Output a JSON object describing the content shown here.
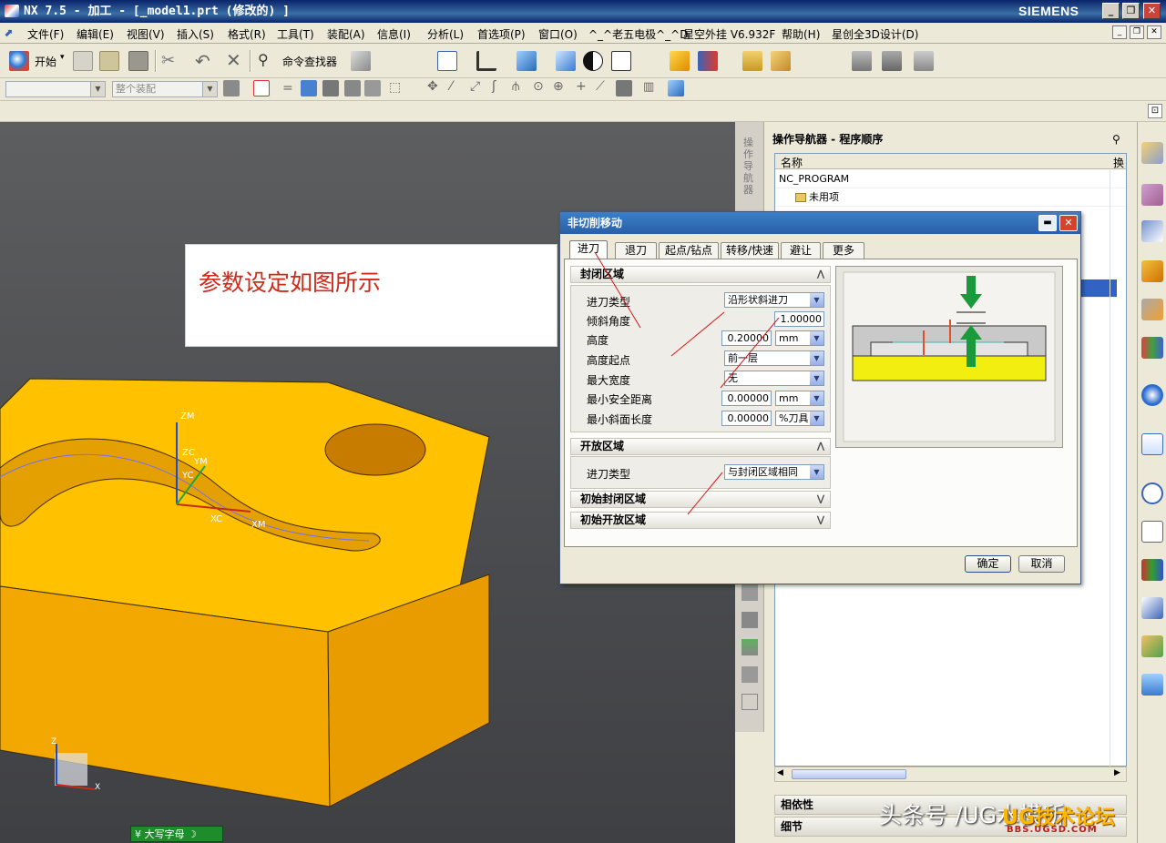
{
  "window": {
    "title": "NX 7.5 - 加工 - [_model1.prt  (修改的) ]",
    "brand": "SIEMENS",
    "minimize": "_",
    "restore": "❐",
    "close": "✕"
  },
  "menubar": {
    "items": [
      "文件(F)",
      "编辑(E)",
      "视图(V)",
      "插入(S)",
      "格式(R)",
      "工具(T)",
      "装配(A)",
      "信息(I)",
      "分析(L)",
      "首选项(P)",
      "窗口(O)",
      "^_^老五电极^_^D",
      "星空外挂 V6.932F",
      "帮助(H)",
      "星创全3D设计(D)"
    ]
  },
  "toolbar": {
    "start_label": "开始",
    "command_finder_label": "命令查找器",
    "filter_placeholder": "",
    "assembly_combo": "整个装配"
  },
  "viewport": {
    "note": "参数设定如图所示",
    "axis_labels": [
      "ZM",
      "ZC",
      "YM",
      "YC",
      "XC",
      "XM"
    ],
    "triad_labels": [
      "Z",
      "X"
    ]
  },
  "navigator": {
    "title": "操作导航器 - 程序顺序",
    "col_name": "名称",
    "col_change": "换",
    "rows": [
      "NC_PROGRAM",
      "未用项"
    ],
    "strip_label": "操作导航器",
    "panel_dependency": "相依性",
    "panel_detail": "细节"
  },
  "dialog": {
    "title": "非切削移动",
    "tabs": [
      "进刀",
      "退刀",
      "起点/钻点",
      "转移/快速",
      "避让",
      "更多"
    ],
    "closed_section": "封闭区域",
    "fields": {
      "entry_type_label": "进刀类型",
      "entry_type_value": "沿形状斜进刀",
      "ramp_angle_label": "倾斜角度",
      "ramp_angle_value": "1.00000",
      "height_label": "高度",
      "height_value": "0.20000",
      "height_unit": "mm",
      "height_from_label": "高度起点",
      "height_from_value": "前一层",
      "max_width_label": "最大宽度",
      "max_width_value": "无",
      "min_clear_label": "最小安全距离",
      "min_clear_value": "0.00000",
      "min_clear_unit": "mm",
      "min_ramp_label": "最小斜面长度",
      "min_ramp_value": "0.00000",
      "min_ramp_unit": "%刀具"
    },
    "open_section": "开放区域",
    "open_entry_label": "进刀类型",
    "open_entry_value": "与封闭区域相同",
    "initial_closed": "初始封闭区域",
    "initial_open": "初始开放区域",
    "ok": "确定",
    "cancel": "取消",
    "minimize": "▬",
    "close": "✕"
  },
  "status": {
    "ime": "大写字母"
  },
  "watermark": {
    "text": "头条号 /UG水模所",
    "logo": "UG技术论坛",
    "url": "BBS.UGSD.COM"
  }
}
